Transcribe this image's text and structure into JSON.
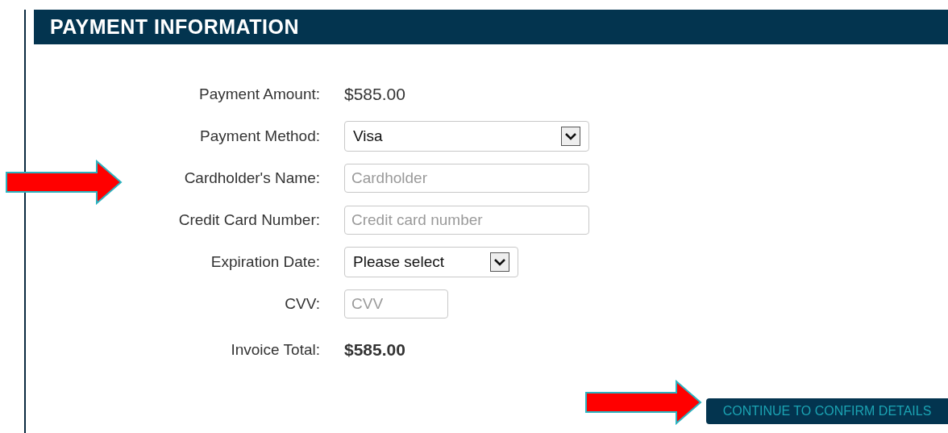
{
  "header": {
    "title": "PAYMENT INFORMATION"
  },
  "fields": [
    {
      "kind": "text",
      "label": "Payment Amount:",
      "value": "$585.00"
    },
    {
      "kind": "select",
      "label": "Payment Method:",
      "value": "Visa"
    },
    {
      "kind": "input",
      "label": "Cardholder's Name:",
      "placeholder": "Cardholder"
    },
    {
      "kind": "input",
      "label": "Credit Card Number:",
      "placeholder": "Credit card number"
    },
    {
      "kind": "select",
      "label": "Expiration Date:",
      "value": "Please select"
    },
    {
      "kind": "input",
      "label": "CVV:",
      "placeholder": "CVV"
    },
    {
      "kind": "total",
      "label": "Invoice Total:",
      "value": "$585.00"
    }
  ],
  "button": {
    "label": "CONTINUE TO CONFIRM DETAILS"
  }
}
